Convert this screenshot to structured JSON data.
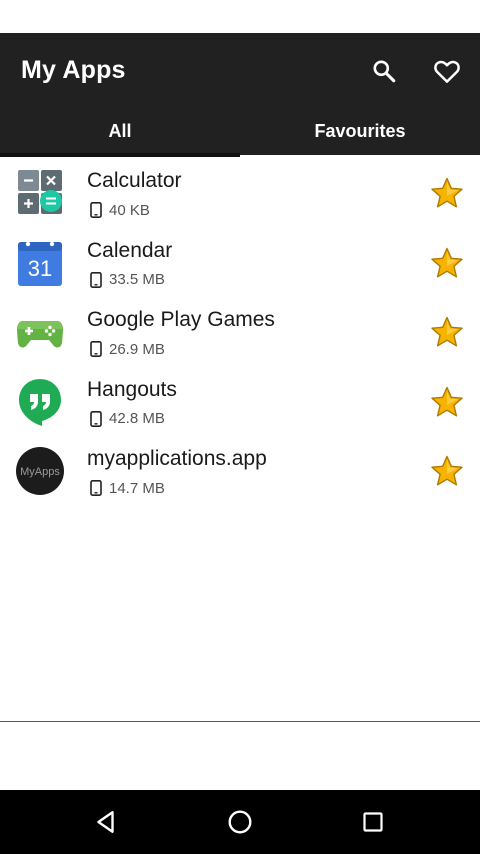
{
  "app": {
    "title": "My Apps"
  },
  "actions": {
    "search_icon": "search-icon",
    "favourites_icon": "heart-icon"
  },
  "tabs": [
    {
      "label": "All",
      "selected": true
    },
    {
      "label": "Favourites",
      "selected": false
    }
  ],
  "apps": [
    {
      "name": "Calculator",
      "size": "40 KB",
      "icon": "calculator-icon",
      "starred": true
    },
    {
      "name": "Calendar",
      "size": "33.5 MB",
      "icon": "calendar-icon",
      "icon_text": "31",
      "starred": true
    },
    {
      "name": "Google Play Games",
      "size": "26.9 MB",
      "icon": "gamepad-icon",
      "starred": true
    },
    {
      "name": "Hangouts",
      "size": "42.8 MB",
      "icon": "hangouts-icon",
      "starred": true
    },
    {
      "name": "myapplications.app",
      "size": "14.7 MB",
      "icon": "myapps-icon",
      "icon_text": "MyApps",
      "starred": true
    }
  ],
  "nav": {
    "back": "back-icon",
    "home": "home-icon",
    "recents": "recents-icon"
  },
  "colors": {
    "appbar": "#212121",
    "star": "#f5b400",
    "calendar_blue": "#3f7be0",
    "games_green": "#63b344",
    "hangouts_green": "#1faa54"
  }
}
